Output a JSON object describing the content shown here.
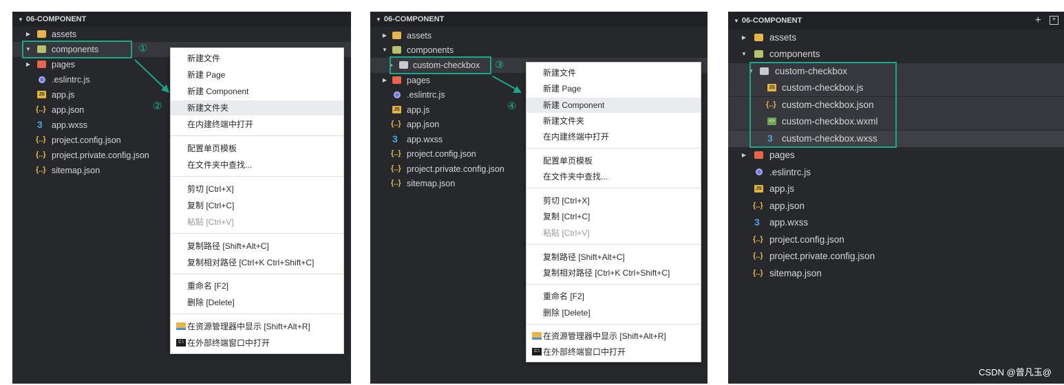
{
  "panel1": {
    "header": "06-COMPONENT",
    "tree": [
      "assets",
      "components",
      "pages",
      ".eslintrc.js",
      "app.js",
      "app.json",
      "app.wxss",
      "project.config.json",
      "project.private.config.json",
      "sitemap.json"
    ],
    "step_a": "①",
    "step_b": "②",
    "menu": [
      "新建文件",
      "新建 Page",
      "新建 Component",
      "新建文件夹",
      "在内建终端中打开",
      "配置单页模板",
      "在文件夹中查找...",
      "剪切  [Ctrl+X]",
      "复制  [Ctrl+C]",
      "粘贴  [Ctrl+V]",
      "复制路径  [Shift+Alt+C]",
      "复制相对路径  [Ctrl+K Ctrl+Shift+C]",
      "重命名  [F2]",
      "删除  [Delete]",
      "在资源管理器中显示  [Shift+Alt+R]",
      "在外部终端窗口中打开"
    ]
  },
  "panel2": {
    "header": "06-COMPONENT",
    "tree": [
      "assets",
      "components",
      "custom-checkbox",
      "pages",
      ".eslintrc.js",
      "app.js",
      "app.json",
      "app.wxss",
      "project.config.json",
      "project.private.config.json",
      "sitemap.json"
    ],
    "step_a": "③",
    "step_b": "④",
    "menu": [
      "新建文件",
      "新建 Page",
      "新建 Component",
      "新建文件夹",
      "在内建终端中打开",
      "配置单页模板",
      "在文件夹中查找...",
      "剪切  [Ctrl+X]",
      "复制  [Ctrl+C]",
      "粘贴  [Ctrl+V]",
      "复制路径  [Shift+Alt+C]",
      "复制相对路径  [Ctrl+K Ctrl+Shift+C]",
      "重命名  [F2]",
      "删除  [Delete]",
      "在资源管理器中显示  [Shift+Alt+R]",
      "在外部终端窗口中打开"
    ]
  },
  "panel3": {
    "header": "06-COMPONENT",
    "tree": [
      "assets",
      "components",
      "custom-checkbox",
      "custom-checkbox.js",
      "custom-checkbox.json",
      "custom-checkbox.wxml",
      "custom-checkbox.wxss",
      "pages",
      ".eslintrc.js",
      "app.js",
      "app.json",
      "app.wxss",
      "project.config.json",
      "project.private.config.json",
      "sitemap.json"
    ]
  },
  "watermark": "CSDN @曾凡玉@",
  "colors": {
    "highlight": "#1aa88b",
    "panel_bg": "#27282c",
    "menu_bg": "#ffffff"
  },
  "icons": [
    "folder-icon",
    "js-file-icon",
    "json-file-icon",
    "wxss-file-icon",
    "wxml-file-icon",
    "eslint-icon",
    "explorer-icon",
    "terminal-icon",
    "new-file-plus-icon",
    "new-folder-icon"
  ]
}
